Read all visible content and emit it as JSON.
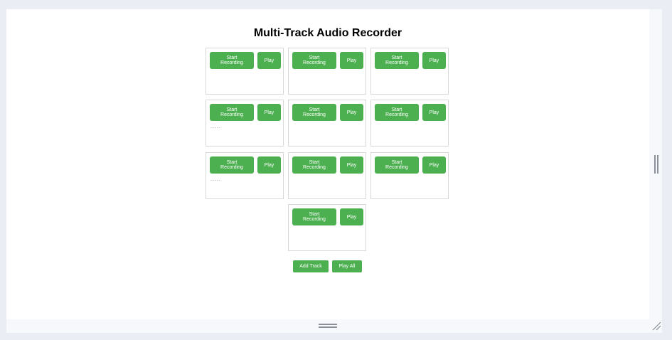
{
  "app": {
    "title": "Multi-Track Audio Recorder"
  },
  "labels": {
    "record": "Start Recording",
    "play": "Play"
  },
  "tracks": [
    {
      "has_waveform": false
    },
    {
      "has_waveform": false
    },
    {
      "has_waveform": false
    },
    {
      "has_waveform": true
    },
    {
      "has_waveform": false
    },
    {
      "has_waveform": false
    },
    {
      "has_waveform": true
    },
    {
      "has_waveform": false
    },
    {
      "has_waveform": false
    },
    {
      "has_waveform": false
    }
  ],
  "controls": {
    "add_track": "Add Track",
    "play_all": "Play All"
  },
  "colors": {
    "button": "#4caf50",
    "button_text": "#ffffff",
    "track_border": "#d8d8d8",
    "background": "#ffffff",
    "chrome": "#eaedf3"
  }
}
